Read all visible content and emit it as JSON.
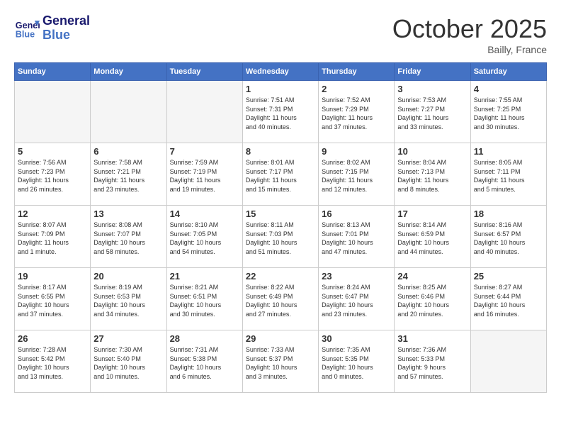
{
  "header": {
    "logo_line1": "General",
    "logo_line2": "Blue",
    "month": "October 2025",
    "location": "Bailly, France"
  },
  "weekdays": [
    "Sunday",
    "Monday",
    "Tuesday",
    "Wednesday",
    "Thursday",
    "Friday",
    "Saturday"
  ],
  "weeks": [
    [
      {
        "day": "",
        "info": ""
      },
      {
        "day": "",
        "info": ""
      },
      {
        "day": "",
        "info": ""
      },
      {
        "day": "1",
        "info": "Sunrise: 7:51 AM\nSunset: 7:31 PM\nDaylight: 11 hours\nand 40 minutes."
      },
      {
        "day": "2",
        "info": "Sunrise: 7:52 AM\nSunset: 7:29 PM\nDaylight: 11 hours\nand 37 minutes."
      },
      {
        "day": "3",
        "info": "Sunrise: 7:53 AM\nSunset: 7:27 PM\nDaylight: 11 hours\nand 33 minutes."
      },
      {
        "day": "4",
        "info": "Sunrise: 7:55 AM\nSunset: 7:25 PM\nDaylight: 11 hours\nand 30 minutes."
      }
    ],
    [
      {
        "day": "5",
        "info": "Sunrise: 7:56 AM\nSunset: 7:23 PM\nDaylight: 11 hours\nand 26 minutes."
      },
      {
        "day": "6",
        "info": "Sunrise: 7:58 AM\nSunset: 7:21 PM\nDaylight: 11 hours\nand 23 minutes."
      },
      {
        "day": "7",
        "info": "Sunrise: 7:59 AM\nSunset: 7:19 PM\nDaylight: 11 hours\nand 19 minutes."
      },
      {
        "day": "8",
        "info": "Sunrise: 8:01 AM\nSunset: 7:17 PM\nDaylight: 11 hours\nand 15 minutes."
      },
      {
        "day": "9",
        "info": "Sunrise: 8:02 AM\nSunset: 7:15 PM\nDaylight: 11 hours\nand 12 minutes."
      },
      {
        "day": "10",
        "info": "Sunrise: 8:04 AM\nSunset: 7:13 PM\nDaylight: 11 hours\nand 8 minutes."
      },
      {
        "day": "11",
        "info": "Sunrise: 8:05 AM\nSunset: 7:11 PM\nDaylight: 11 hours\nand 5 minutes."
      }
    ],
    [
      {
        "day": "12",
        "info": "Sunrise: 8:07 AM\nSunset: 7:09 PM\nDaylight: 11 hours\nand 1 minute."
      },
      {
        "day": "13",
        "info": "Sunrise: 8:08 AM\nSunset: 7:07 PM\nDaylight: 10 hours\nand 58 minutes."
      },
      {
        "day": "14",
        "info": "Sunrise: 8:10 AM\nSunset: 7:05 PM\nDaylight: 10 hours\nand 54 minutes."
      },
      {
        "day": "15",
        "info": "Sunrise: 8:11 AM\nSunset: 7:03 PM\nDaylight: 10 hours\nand 51 minutes."
      },
      {
        "day": "16",
        "info": "Sunrise: 8:13 AM\nSunset: 7:01 PM\nDaylight: 10 hours\nand 47 minutes."
      },
      {
        "day": "17",
        "info": "Sunrise: 8:14 AM\nSunset: 6:59 PM\nDaylight: 10 hours\nand 44 minutes."
      },
      {
        "day": "18",
        "info": "Sunrise: 8:16 AM\nSunset: 6:57 PM\nDaylight: 10 hours\nand 40 minutes."
      }
    ],
    [
      {
        "day": "19",
        "info": "Sunrise: 8:17 AM\nSunset: 6:55 PM\nDaylight: 10 hours\nand 37 minutes."
      },
      {
        "day": "20",
        "info": "Sunrise: 8:19 AM\nSunset: 6:53 PM\nDaylight: 10 hours\nand 34 minutes."
      },
      {
        "day": "21",
        "info": "Sunrise: 8:21 AM\nSunset: 6:51 PM\nDaylight: 10 hours\nand 30 minutes."
      },
      {
        "day": "22",
        "info": "Sunrise: 8:22 AM\nSunset: 6:49 PM\nDaylight: 10 hours\nand 27 minutes."
      },
      {
        "day": "23",
        "info": "Sunrise: 8:24 AM\nSunset: 6:47 PM\nDaylight: 10 hours\nand 23 minutes."
      },
      {
        "day": "24",
        "info": "Sunrise: 8:25 AM\nSunset: 6:46 PM\nDaylight: 10 hours\nand 20 minutes."
      },
      {
        "day": "25",
        "info": "Sunrise: 8:27 AM\nSunset: 6:44 PM\nDaylight: 10 hours\nand 16 minutes."
      }
    ],
    [
      {
        "day": "26",
        "info": "Sunrise: 7:28 AM\nSunset: 5:42 PM\nDaylight: 10 hours\nand 13 minutes."
      },
      {
        "day": "27",
        "info": "Sunrise: 7:30 AM\nSunset: 5:40 PM\nDaylight: 10 hours\nand 10 minutes."
      },
      {
        "day": "28",
        "info": "Sunrise: 7:31 AM\nSunset: 5:38 PM\nDaylight: 10 hours\nand 6 minutes."
      },
      {
        "day": "29",
        "info": "Sunrise: 7:33 AM\nSunset: 5:37 PM\nDaylight: 10 hours\nand 3 minutes."
      },
      {
        "day": "30",
        "info": "Sunrise: 7:35 AM\nSunset: 5:35 PM\nDaylight: 10 hours\nand 0 minutes."
      },
      {
        "day": "31",
        "info": "Sunrise: 7:36 AM\nSunset: 5:33 PM\nDaylight: 9 hours\nand 57 minutes."
      },
      {
        "day": "",
        "info": ""
      }
    ]
  ]
}
